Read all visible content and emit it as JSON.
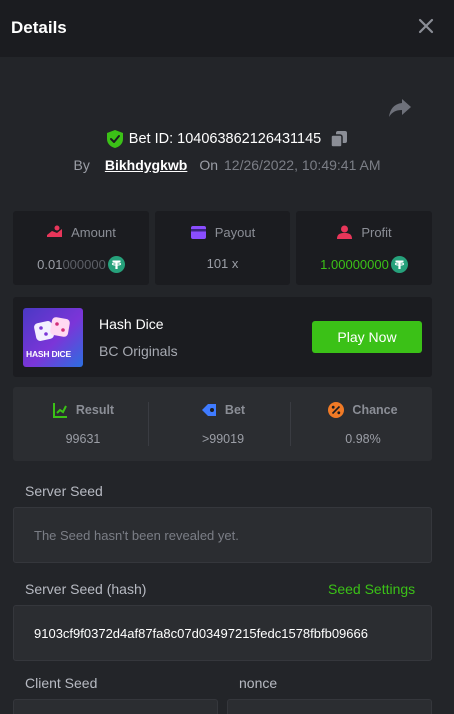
{
  "header": {
    "title": "Details"
  },
  "bet": {
    "id_text": "Bet ID: 104063862126431145",
    "by_label": "By",
    "username": "Bikhdygkwb",
    "on_label": "On",
    "date": "12/26/2022, 10:49:41 AM"
  },
  "stats": {
    "amount": {
      "label": "Amount",
      "value_main": "0.01",
      "value_dim": "000000"
    },
    "payout": {
      "label": "Payout",
      "value": "101 x"
    },
    "profit": {
      "label": "Profit",
      "value_main": "1.",
      "value_dim": "00000000"
    }
  },
  "game": {
    "thumb_text": "HASH DICE",
    "name": "Hash Dice",
    "provider": "BC Originals",
    "play_label": "Play Now"
  },
  "result": {
    "result_label": "Result",
    "result_value": "99631",
    "bet_label": "Bet",
    "bet_value": ">99019",
    "chance_label": "Chance",
    "chance_value": "0.98%"
  },
  "seeds": {
    "server_seed_label": "Server Seed",
    "server_seed_value": "The Seed hasn't been revealed yet.",
    "server_hash_label": "Server Seed (hash)",
    "seed_settings_label": "Seed Settings",
    "server_hash_value": "9103cf9f0372d4af87fa8c07d03497215fedc1578fbfb09666",
    "client_seed_label": "Client Seed",
    "nonce_label": "nonce"
  },
  "colors": {
    "accent_green": "#3bc117",
    "header_bg": "#1b1c20",
    "panel_bg": "#232529",
    "tether_teal": "#26a17b"
  },
  "icons": [
    "close-icon",
    "share-icon",
    "shield-check-icon",
    "copy-icon",
    "amount-icon",
    "payout-icon",
    "profit-icon",
    "tether-coin-icon",
    "result-icon",
    "bet-icon",
    "chance-icon"
  ]
}
